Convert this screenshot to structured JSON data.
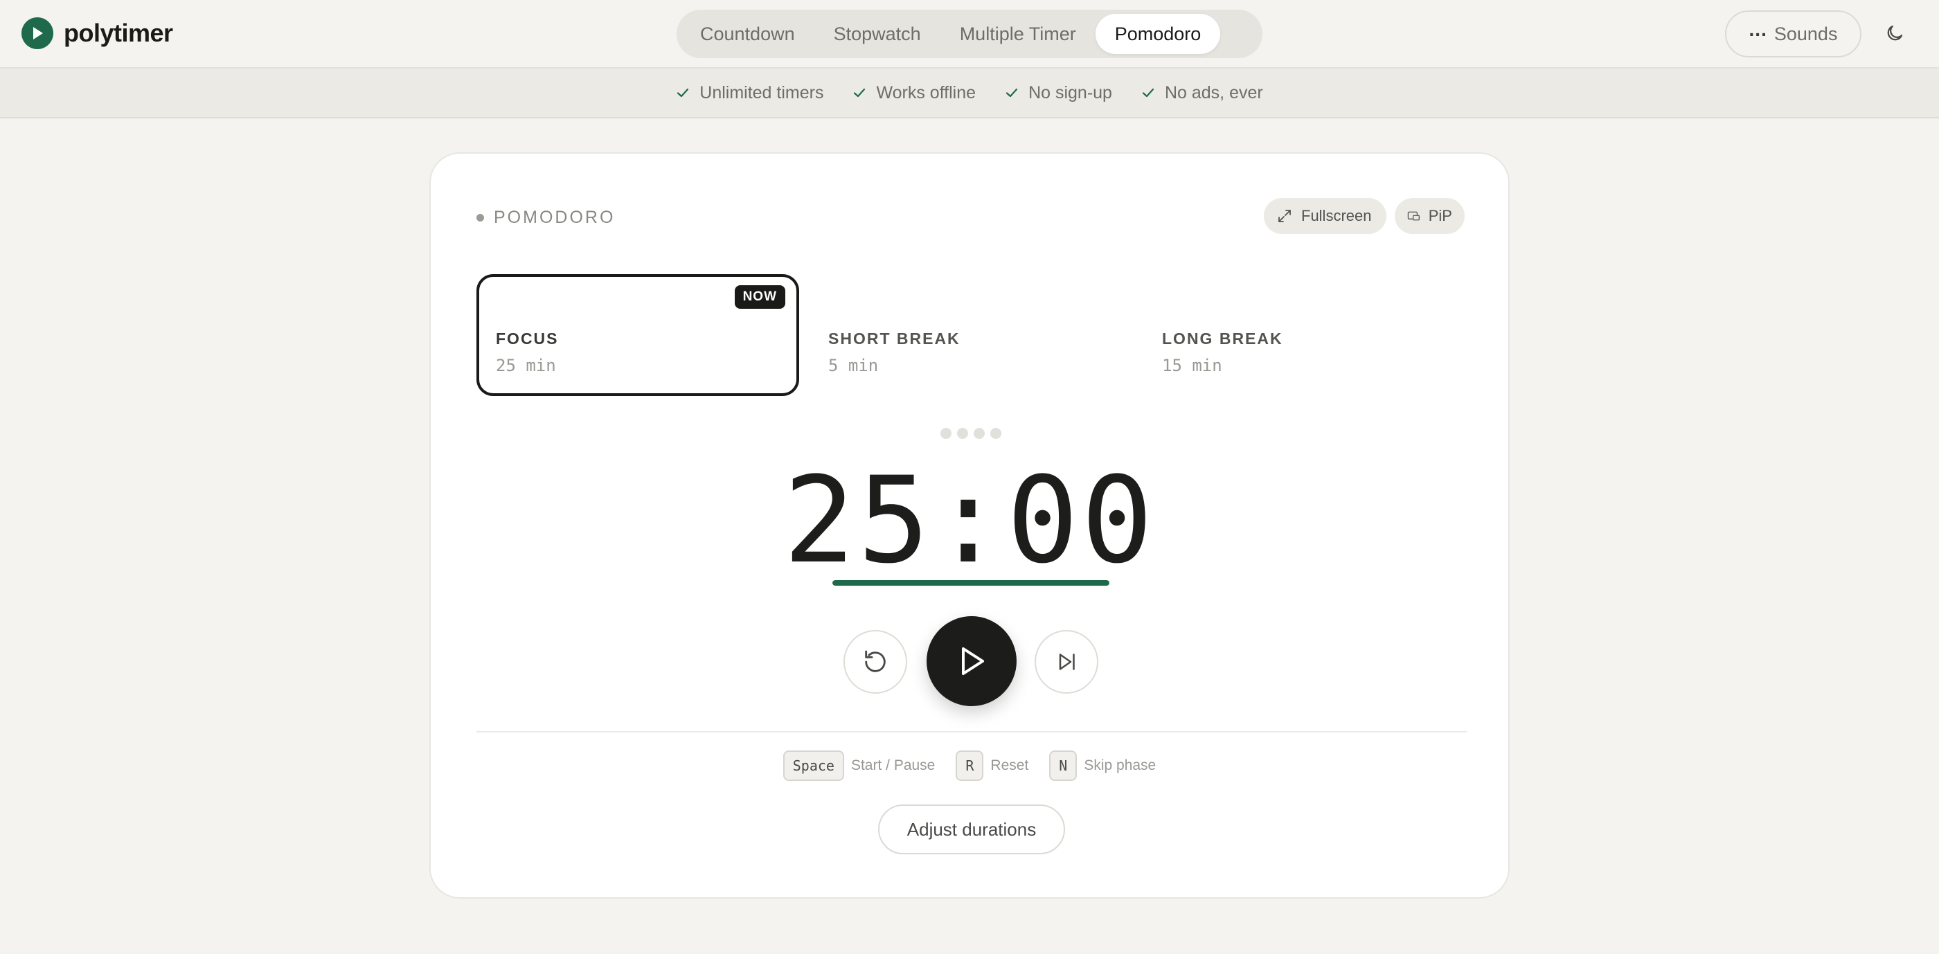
{
  "app": {
    "name": "polytimer",
    "brand_color": "#1e6a4a",
    "logo_icon": "play-circle-icon"
  },
  "nav": {
    "tabs": [
      {
        "label": "Countdown",
        "active": false
      },
      {
        "label": "Stopwatch",
        "active": false
      },
      {
        "label": "Multiple Timer",
        "active": false
      },
      {
        "label": "Pomodoro",
        "active": true
      }
    ],
    "sounds_label": "Sounds",
    "sounds_icon": "dots-icon",
    "theme_icon": "moon-icon"
  },
  "features": [
    {
      "label": "Unlimited timers",
      "icon": "check-icon"
    },
    {
      "label": "Works offline",
      "icon": "check-icon"
    },
    {
      "label": "No sign-up",
      "icon": "check-icon"
    },
    {
      "label": "No ads, ever",
      "icon": "check-icon"
    }
  ],
  "card": {
    "mode_label": "POMODORO",
    "fullscreen_label": "Fullscreen",
    "pip_label": "PiP",
    "phases": [
      {
        "name": "FOCUS",
        "duration": "25 min",
        "active": true,
        "badge": "NOW"
      },
      {
        "name": "SHORT BREAK",
        "duration": "5 min",
        "active": false
      },
      {
        "name": "LONG BREAK",
        "duration": "15 min",
        "active": false
      }
    ],
    "cycle_dots_total": 4,
    "cycle_dots_completed": 0,
    "time": "25:00",
    "progress_fraction": 1.0,
    "shortcuts": [
      {
        "key": "Space",
        "label": "Start / Pause"
      },
      {
        "key": "R",
        "label": "Reset"
      },
      {
        "key": "N",
        "label": "Skip phase"
      }
    ],
    "adjust_label": "Adjust durations"
  }
}
